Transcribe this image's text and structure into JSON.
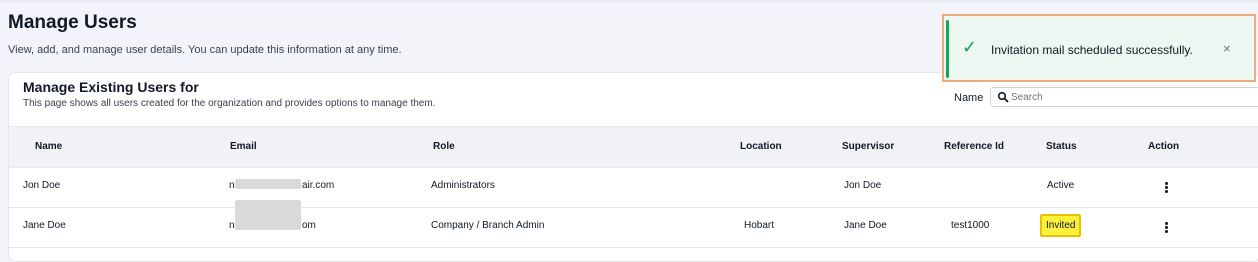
{
  "header": {
    "title": "Manage Users",
    "subtitle": "View, add, and manage user details. You can update this information at any time."
  },
  "card": {
    "title": "Manage Existing Users for",
    "subtitle": "This page shows all users created for the organization and provides options to manage them."
  },
  "filter": {
    "label": "Name",
    "placeholder": "Search",
    "value": ""
  },
  "table": {
    "columns": [
      "Name",
      "Email",
      "Role",
      "Location",
      "Supervisor",
      "Reference Id",
      "Status",
      "Action"
    ],
    "rows": [
      {
        "name": "Jon Doe",
        "email_prefix": "n",
        "email_suffix": "air.com",
        "role": "Administrators",
        "location": "",
        "supervisor": "Jon Doe",
        "reference_id": "",
        "status": "Active"
      },
      {
        "name": "Jane Doe",
        "email_prefix": "n",
        "email_suffix": "om",
        "role": "Company / Branch Admin",
        "location": "Hobart",
        "supervisor": "Jane Doe",
        "reference_id": "test1000",
        "status": "Invited"
      }
    ]
  },
  "toast": {
    "message": "Invitation mail scheduled successfully.",
    "check_glyph": "✓",
    "close_glyph": "×",
    "accent_color": "#16a35b",
    "highlight_border": "#f0a87d"
  },
  "colors": {
    "invited_badge_bg": "#fbf13c",
    "invited_badge_border": "#e8c200"
  },
  "icons": {
    "search": "search-icon",
    "action": "kebab-menu-icon",
    "toast_status": "check-icon",
    "toast_close": "close-icon"
  }
}
